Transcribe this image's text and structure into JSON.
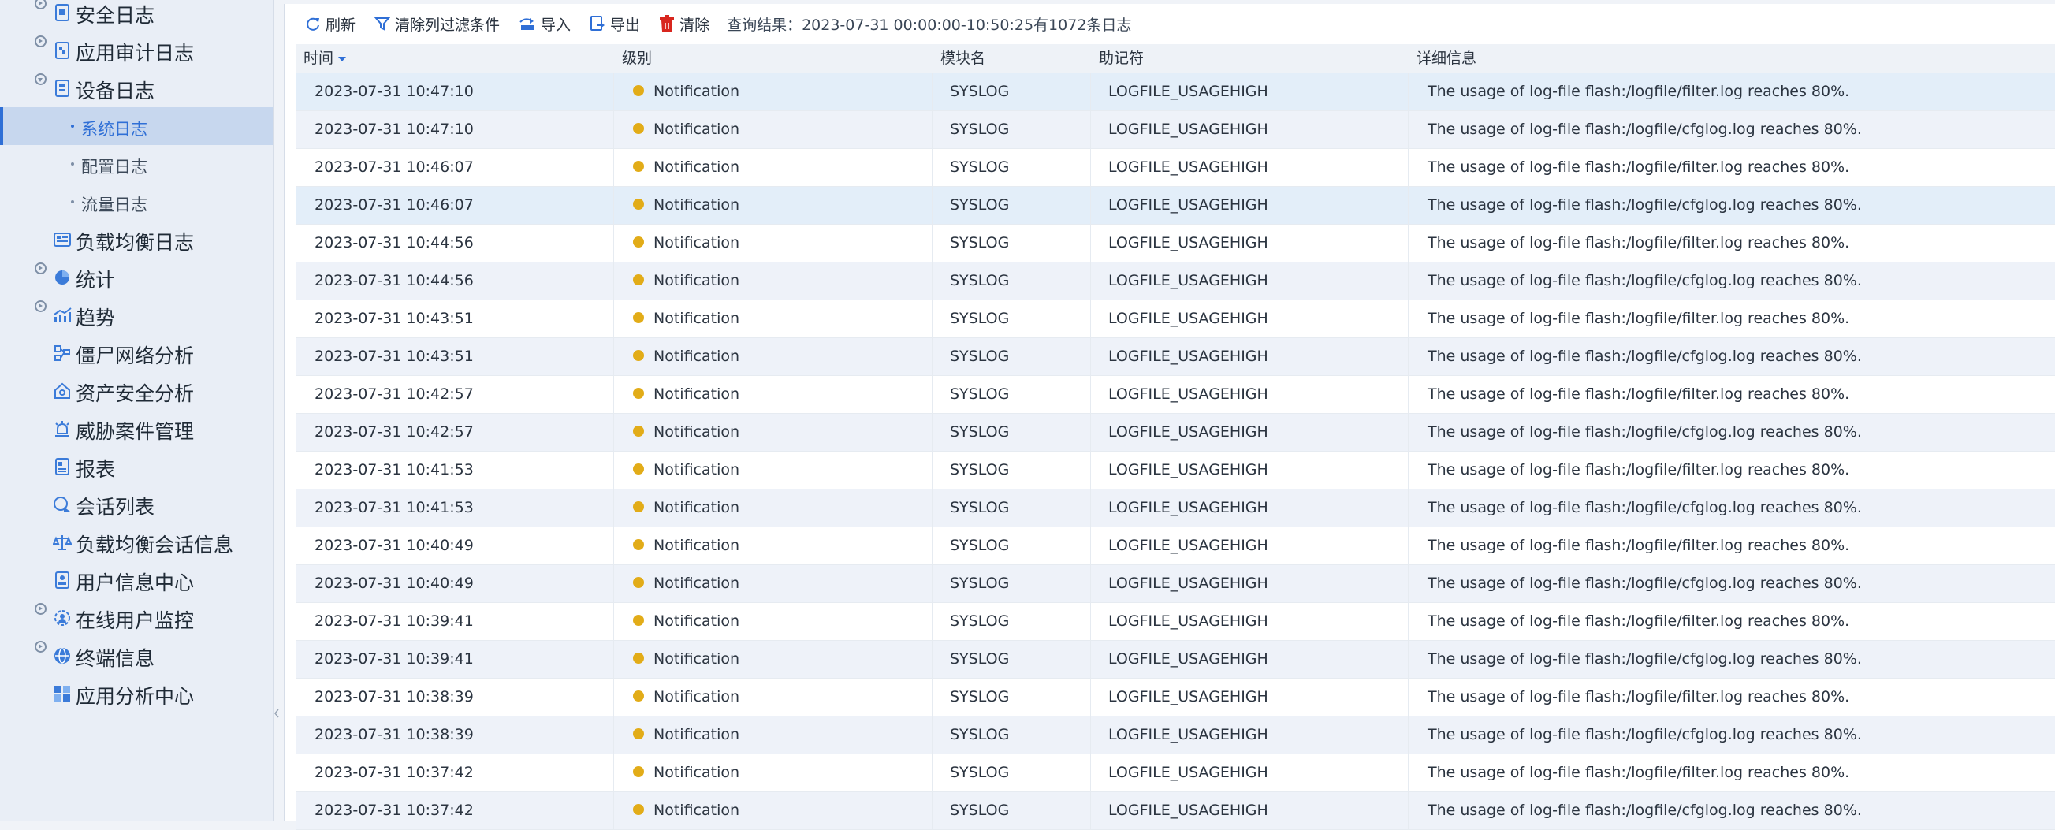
{
  "sidebar": {
    "items": [
      {
        "label": "安全日志",
        "icon": "document-shield-icon",
        "expandable": true,
        "expanded": false
      },
      {
        "label": "应用审计日志",
        "icon": "document-audit-icon",
        "expandable": true,
        "expanded": false
      },
      {
        "label": "设备日志",
        "icon": "document-device-icon",
        "expandable": true,
        "expanded": true
      },
      {
        "label": "负载均衡日志",
        "icon": "list-card-icon",
        "expandable": false
      },
      {
        "label": "统计",
        "icon": "pie-chart-icon",
        "expandable": true,
        "expanded": false
      },
      {
        "label": "趋势",
        "icon": "trend-chart-icon",
        "expandable": true,
        "expanded": false
      },
      {
        "label": "僵尸网络分析",
        "icon": "network-icon",
        "expandable": false
      },
      {
        "label": "资产安全分析",
        "icon": "house-shield-icon",
        "expandable": false
      },
      {
        "label": "威胁案件管理",
        "icon": "alarm-icon",
        "expandable": false
      },
      {
        "label": "报表",
        "icon": "report-icon",
        "expandable": false
      },
      {
        "label": "会话列表",
        "icon": "session-icon",
        "expandable": false
      },
      {
        "label": "负载均衡会话信息",
        "icon": "balance-icon",
        "expandable": false
      },
      {
        "label": "用户信息中心",
        "icon": "user-doc-icon",
        "expandable": false
      },
      {
        "label": "在线用户监控",
        "icon": "online-user-icon",
        "expandable": true,
        "expanded": false
      },
      {
        "label": "终端信息",
        "icon": "terminal-globe-icon",
        "expandable": true,
        "expanded": false
      },
      {
        "label": "应用分析中心",
        "icon": "app-grid-icon",
        "expandable": false
      }
    ],
    "device_log_children": [
      {
        "label": "系统日志",
        "selected": true
      },
      {
        "label": "配置日志",
        "selected": false
      },
      {
        "label": "流量日志",
        "selected": false
      }
    ]
  },
  "toolbar": {
    "refresh_label": "刷新",
    "clear_filter_label": "清除列过滤条件",
    "import_label": "导入",
    "export_label": "导出",
    "clear_label": "清除",
    "query_summary": "查询结果：2023-07-31 00:00:00-10:50:25有1072条日志"
  },
  "table": {
    "columns": [
      "时间",
      "级别",
      "模块名",
      "助记符",
      "详细信息"
    ],
    "rows": [
      {
        "time": "2023-07-31 10:47:10",
        "level": "Notification",
        "module": "SYSLOG",
        "mnemonic": "LOGFILE_USAGEHIGH",
        "detail": "The usage of log-file flash:/logfile/filter.log reaches 80%."
      },
      {
        "time": "2023-07-31 10:47:10",
        "level": "Notification",
        "module": "SYSLOG",
        "mnemonic": "LOGFILE_USAGEHIGH",
        "detail": "The usage of log-file flash:/logfile/cfglog.log reaches 80%."
      },
      {
        "time": "2023-07-31 10:46:07",
        "level": "Notification",
        "module": "SYSLOG",
        "mnemonic": "LOGFILE_USAGEHIGH",
        "detail": "The usage of log-file flash:/logfile/filter.log reaches 80%."
      },
      {
        "time": "2023-07-31 10:46:07",
        "level": "Notification",
        "module": "SYSLOG",
        "mnemonic": "LOGFILE_USAGEHIGH",
        "detail": "The usage of log-file flash:/logfile/cfglog.log reaches 80%."
      },
      {
        "time": "2023-07-31 10:44:56",
        "level": "Notification",
        "module": "SYSLOG",
        "mnemonic": "LOGFILE_USAGEHIGH",
        "detail": "The usage of log-file flash:/logfile/filter.log reaches 80%."
      },
      {
        "time": "2023-07-31 10:44:56",
        "level": "Notification",
        "module": "SYSLOG",
        "mnemonic": "LOGFILE_USAGEHIGH",
        "detail": "The usage of log-file flash:/logfile/cfglog.log reaches 80%."
      },
      {
        "time": "2023-07-31 10:43:51",
        "level": "Notification",
        "module": "SYSLOG",
        "mnemonic": "LOGFILE_USAGEHIGH",
        "detail": "The usage of log-file flash:/logfile/filter.log reaches 80%."
      },
      {
        "time": "2023-07-31 10:43:51",
        "level": "Notification",
        "module": "SYSLOG",
        "mnemonic": "LOGFILE_USAGEHIGH",
        "detail": "The usage of log-file flash:/logfile/cfglog.log reaches 80%."
      },
      {
        "time": "2023-07-31 10:42:57",
        "level": "Notification",
        "module": "SYSLOG",
        "mnemonic": "LOGFILE_USAGEHIGH",
        "detail": "The usage of log-file flash:/logfile/filter.log reaches 80%."
      },
      {
        "time": "2023-07-31 10:42:57",
        "level": "Notification",
        "module": "SYSLOG",
        "mnemonic": "LOGFILE_USAGEHIGH",
        "detail": "The usage of log-file flash:/logfile/cfglog.log reaches 80%."
      },
      {
        "time": "2023-07-31 10:41:53",
        "level": "Notification",
        "module": "SYSLOG",
        "mnemonic": "LOGFILE_USAGEHIGH",
        "detail": "The usage of log-file flash:/logfile/filter.log reaches 80%."
      },
      {
        "time": "2023-07-31 10:41:53",
        "level": "Notification",
        "module": "SYSLOG",
        "mnemonic": "LOGFILE_USAGEHIGH",
        "detail": "The usage of log-file flash:/logfile/cfglog.log reaches 80%."
      },
      {
        "time": "2023-07-31 10:40:49",
        "level": "Notification",
        "module": "SYSLOG",
        "mnemonic": "LOGFILE_USAGEHIGH",
        "detail": "The usage of log-file flash:/logfile/filter.log reaches 80%."
      },
      {
        "time": "2023-07-31 10:40:49",
        "level": "Notification",
        "module": "SYSLOG",
        "mnemonic": "LOGFILE_USAGEHIGH",
        "detail": "The usage of log-file flash:/logfile/cfglog.log reaches 80%."
      },
      {
        "time": "2023-07-31 10:39:41",
        "level": "Notification",
        "module": "SYSLOG",
        "mnemonic": "LOGFILE_USAGEHIGH",
        "detail": "The usage of log-file flash:/logfile/filter.log reaches 80%."
      },
      {
        "time": "2023-07-31 10:39:41",
        "level": "Notification",
        "module": "SYSLOG",
        "mnemonic": "LOGFILE_USAGEHIGH",
        "detail": "The usage of log-file flash:/logfile/cfglog.log reaches 80%."
      },
      {
        "time": "2023-07-31 10:38:39",
        "level": "Notification",
        "module": "SYSLOG",
        "mnemonic": "LOGFILE_USAGEHIGH",
        "detail": "The usage of log-file flash:/logfile/filter.log reaches 80%."
      },
      {
        "time": "2023-07-31 10:38:39",
        "level": "Notification",
        "module": "SYSLOG",
        "mnemonic": "LOGFILE_USAGEHIGH",
        "detail": "The usage of log-file flash:/logfile/cfglog.log reaches 80%."
      },
      {
        "time": "2023-07-31 10:37:42",
        "level": "Notification",
        "module": "SYSLOG",
        "mnemonic": "LOGFILE_USAGEHIGH",
        "detail": "The usage of log-file flash:/logfile/filter.log reaches 80%."
      },
      {
        "time": "2023-07-31 10:37:42",
        "level": "Notification",
        "module": "SYSLOG",
        "mnemonic": "LOGFILE_USAGEHIGH",
        "detail": "The usage of log-file flash:/logfile/cfglog.log reaches 80%."
      }
    ]
  },
  "colors": {
    "accent": "#2f6fd6",
    "selected_bg": "#c7d7ee",
    "notification_dot": "#e2ac18",
    "clear_icon": "#d8261e"
  }
}
